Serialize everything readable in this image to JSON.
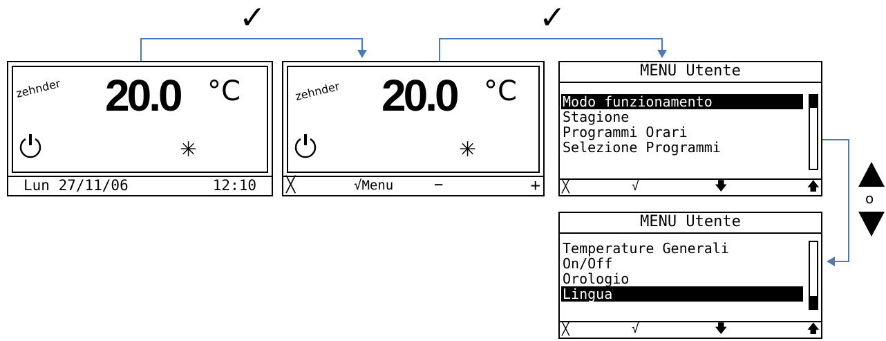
{
  "colors": {
    "connector": "#4a7ab8",
    "lcd_fg": "#000000",
    "lcd_bg": "#ffffff"
  },
  "step_marks": [
    "✓",
    "✓"
  ],
  "main_screen": {
    "brand": "zehnder",
    "temperature": "20.0",
    "unit": "°C",
    "power_icon": "power-icon",
    "mode_icon": "snowflake-icon",
    "date": "Lun 27/11/06",
    "time": "12:10"
  },
  "main_screen_selected": {
    "brand": "zehnder",
    "temperature": "20.0",
    "unit": "°C",
    "softkeys": {
      "cancel": "╳",
      "confirm": "√Menu",
      "minus": "−",
      "plus": "+"
    }
  },
  "menu_top": {
    "title": "MENU Utente",
    "items": [
      "Modo funzionamento",
      "Stagione",
      "Programmi Orari",
      "Selezione Programmi"
    ],
    "selected_index": 0,
    "softkeys": {
      "cancel": "╳",
      "confirm": "√",
      "down": "🡇",
      "up": "🡅"
    }
  },
  "menu_bottom": {
    "title": "MENU Utente",
    "items": [
      "Temperature Generali",
      "On/Off",
      "Orologio",
      "Lingua"
    ],
    "selected_index": 3,
    "softkeys": {
      "cancel": "╳",
      "confirm": "√",
      "down": "🡇",
      "up": "🡅"
    }
  },
  "navigation": {
    "up_icon": "triangle-up-icon",
    "or_label": "o",
    "down_icon": "triangle-down-icon"
  }
}
